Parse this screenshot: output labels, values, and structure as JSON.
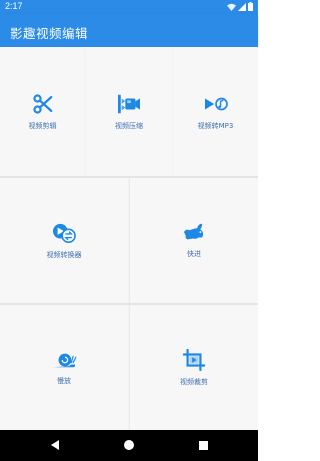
{
  "status_bar": {
    "time": "2:17"
  },
  "app_bar": {
    "title": "影趣视频编辑"
  },
  "tools": {
    "row1": [
      {
        "label": "视频剪辑",
        "icon": "scissors-icon"
      },
      {
        "label": "视频压缩",
        "icon": "compress-icon"
      },
      {
        "label": "视频转MP3",
        "icon": "video-to-mp3-icon"
      }
    ],
    "row2": [
      {
        "label": "视频转换器",
        "icon": "convert-icon"
      },
      {
        "label": "快进",
        "icon": "rabbit-icon"
      }
    ],
    "row3": [
      {
        "label": "慢放",
        "icon": "snail-icon"
      },
      {
        "label": "视频裁剪",
        "icon": "crop-video-icon"
      }
    ]
  },
  "colors": {
    "primary": "#2B8BE7",
    "icon": "#1E88E5",
    "label": "#3E6FB0"
  }
}
